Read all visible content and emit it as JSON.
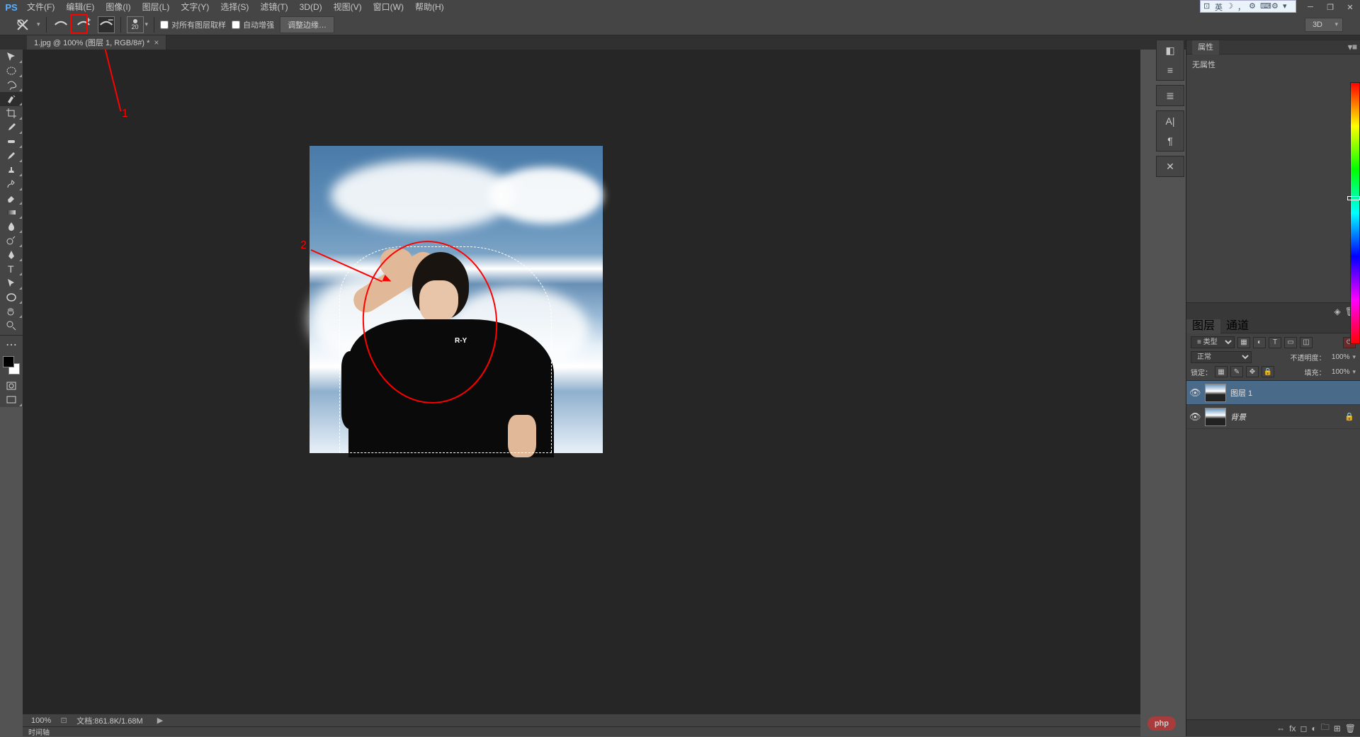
{
  "app": {
    "logo": "PS"
  },
  "menu": {
    "file": "文件(F)",
    "edit": "编辑(E)",
    "image": "图像(I)",
    "layer": "图层(L)",
    "type": "文字(Y)",
    "select": "选择(S)",
    "filter": "滤镜(T)",
    "threed": "3D(D)",
    "view": "视图(V)",
    "window": "窗口(W)",
    "help": "帮助(H)"
  },
  "langbar": {
    "items": [
      "⊡",
      "英",
      "☽",
      "，",
      "⚙",
      "⌨",
      "⚙",
      "▾"
    ]
  },
  "options": {
    "brush_size": "20",
    "sample_all_label": "对所有图层取样",
    "auto_enhance_label": "自动增强",
    "refine_edge_label": "调整边缘…",
    "workspace_label": "3D"
  },
  "document": {
    "tab_label": "1.jpg @ 100% (图层 1, RGB/8#) *"
  },
  "annotations": {
    "label1": "1",
    "label2": "2"
  },
  "canvas_image": {
    "shirt_text": "R-Y"
  },
  "properties_panel": {
    "title": "属性",
    "body": "无属性"
  },
  "layers_panel": {
    "tab_layers": "图层",
    "tab_channels": "通道",
    "kind_label": "≡ 类型",
    "blend_mode": "正常",
    "opacity_label": "不透明度：",
    "opacity_value": "100%",
    "lock_label": "锁定：",
    "fill_label": "填充：",
    "fill_value": "100%",
    "layers": [
      {
        "name": "图层 1",
        "selected": true,
        "locked": false
      },
      {
        "name": "背景",
        "selected": false,
        "locked": true
      }
    ]
  },
  "status": {
    "zoom": "100%",
    "doc_info": "文档:861.8K/1.68M"
  },
  "timeline": {
    "label": "时间轴"
  },
  "watermark": {
    "text": "php"
  }
}
